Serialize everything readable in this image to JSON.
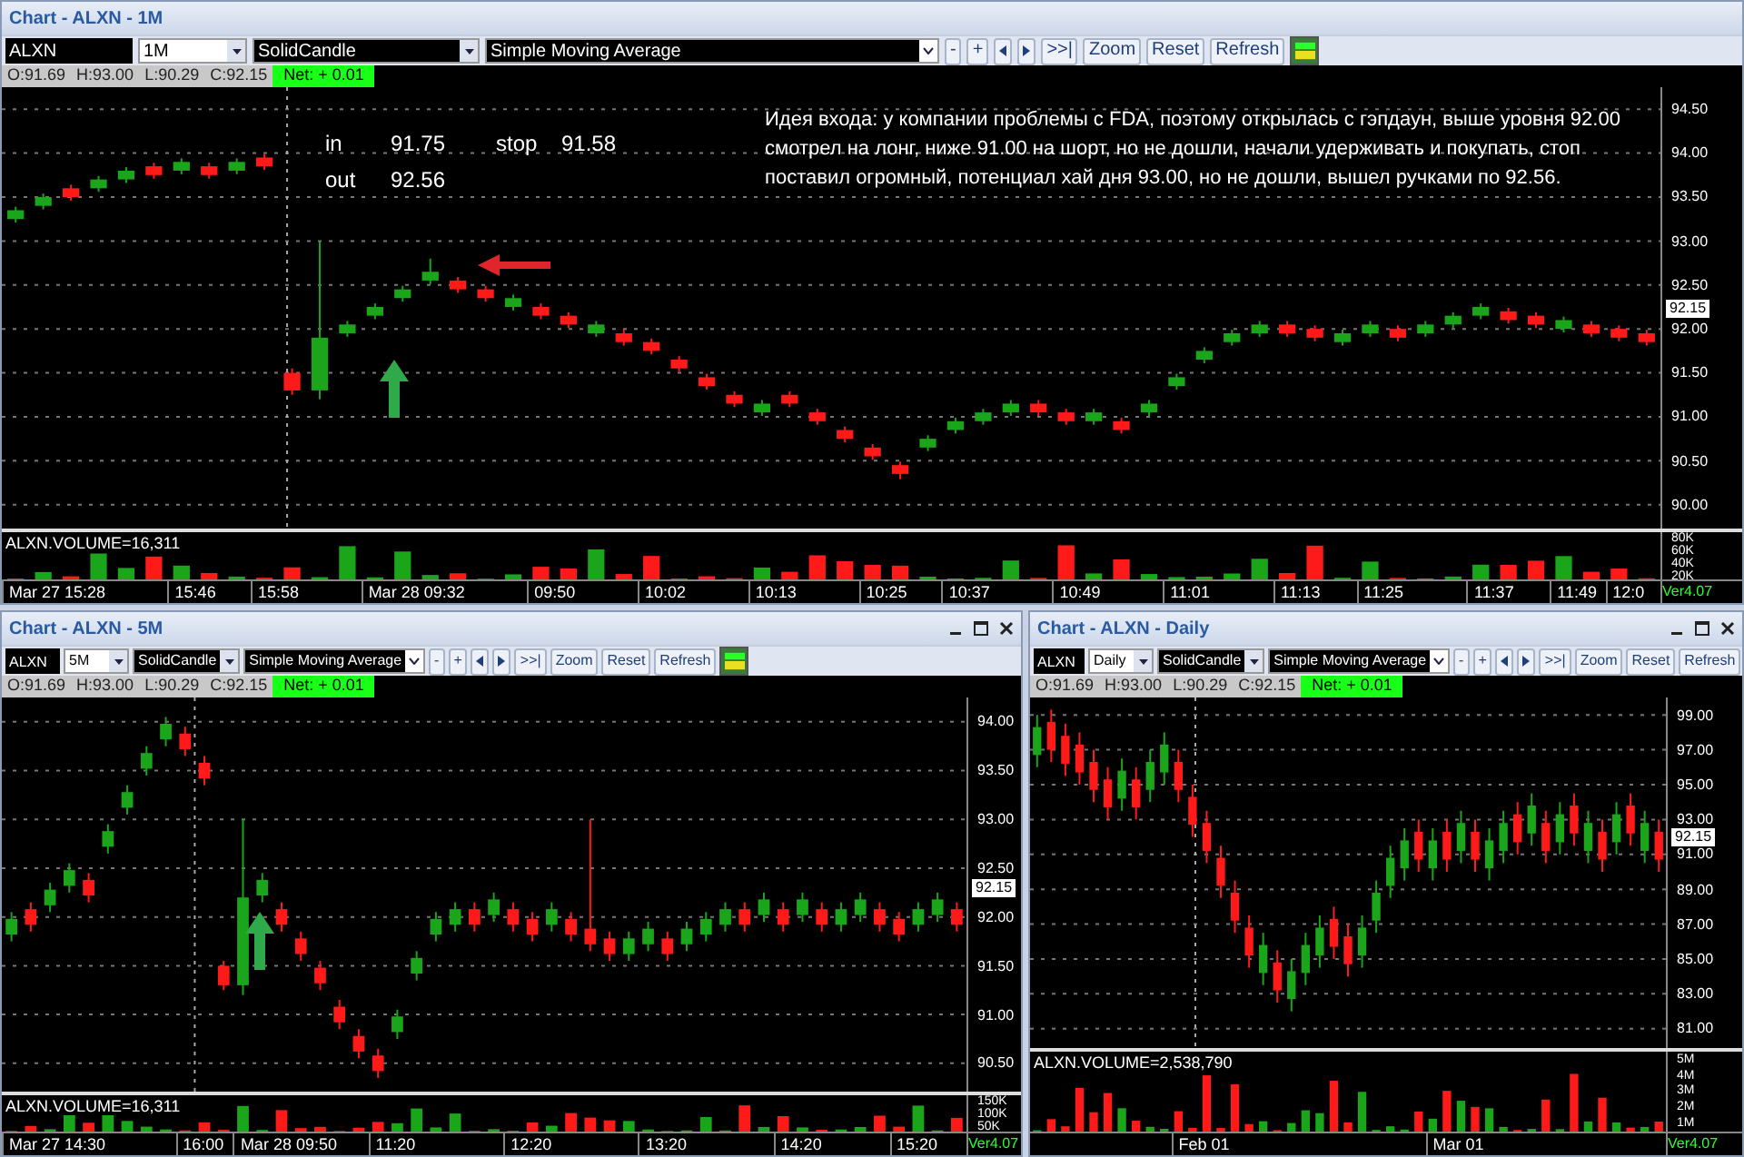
{
  "windows": [
    {
      "title": "Chart - ALXN - 1M",
      "window_controls": false,
      "symbol": "ALXN",
      "interval": "1M",
      "chart_style": "SolidCandle",
      "indicator": "Simple Moving Average",
      "step_buttons": [
        "-",
        "+"
      ],
      "action_buttons": [
        ">>|",
        "Zoom",
        "Reset",
        "Refresh"
      ],
      "quote": [
        "O:91.69",
        "H:93.00",
        "L:90.29",
        "C:92.15"
      ],
      "net": "Net: + 0.01",
      "price_tag": "92.15",
      "volume_label": "ALXN.VOLUME=16,311",
      "volume_axis": [
        "80K",
        "60K",
        "40K",
        "20K"
      ],
      "x_axis": [
        "Mar 27 15:28",
        "15:46",
        "15:58",
        "Mar 28 09:32",
        "09:50",
        "10:02",
        "10:13",
        "10:25",
        "10:37",
        "10:49",
        "11:01",
        "11:13",
        "11:25",
        "11:37",
        "11:49",
        "12:0"
      ],
      "version": "Ver4.07",
      "trade_notes": [
        [
          "in",
          "91.75",
          "stop",
          "91.58"
        ],
        [
          "out",
          "92.56"
        ]
      ],
      "comment": "Идея входа: у компании проблемы с FDA, поэтому открылась с гэпдаун, выше уровня 92.00 смотрел на лонг, ниже 91.00 на шорт, но не дошли, начали удерживать и покупать, стоп поставил огромный, потенциал хай дня 93.00,  но не дошли,   вышел ручками по 92.56.",
      "markers": [
        {
          "kind": "up-arrow"
        },
        {
          "kind": "left-arrow"
        }
      ],
      "chart_data": {
        "type": "candlestick",
        "ylim": [
          89.15,
          94.75
        ],
        "yticks": [
          {
            "value": 94.5,
            "label": "94.50"
          },
          {
            "value": 94,
            "label": "94.00"
          },
          {
            "value": 93.5,
            "label": "93.50"
          },
          {
            "value": 93,
            "label": "93.00"
          },
          {
            "value": 92.5,
            "label": "92.50"
          },
          {
            "value": 92,
            "label": "92.00"
          },
          {
            "value": 91.5,
            "label": "91.50"
          },
          {
            "value": 91,
            "label": "91.00"
          },
          {
            "value": 90.5,
            "label": "90.50"
          },
          {
            "value": 90,
            "label": "90.00"
          }
        ],
        "grid": true,
        "categories": [
          null,
          null,
          null,
          null,
          null,
          null,
          null,
          null,
          null,
          null,
          null,
          null,
          null,
          null,
          null,
          null,
          null,
          null,
          null,
          null,
          null,
          null,
          null,
          null,
          null,
          null,
          null,
          null,
          null,
          null,
          null,
          null,
          null,
          null,
          null,
          null,
          null,
          null,
          null,
          null,
          null,
          null,
          null,
          null,
          null,
          null,
          null,
          null,
          null,
          null,
          null,
          null,
          null,
          null,
          null,
          null,
          null,
          null,
          null,
          null
        ],
        "ohlc": [
          [
            93.25,
            93.39,
            93.21,
            93.35
          ],
          [
            93.4,
            93.54,
            93.36,
            93.5
          ],
          [
            93.6,
            93.64,
            93.46,
            93.5
          ],
          [
            93.6,
            93.74,
            93.56,
            93.7
          ],
          [
            93.7,
            93.84,
            93.66,
            93.8
          ],
          [
            93.85,
            93.89,
            93.71,
            93.75
          ],
          [
            93.8,
            93.94,
            93.76,
            93.9
          ],
          [
            93.85,
            93.89,
            93.71,
            93.75
          ],
          [
            93.8,
            93.94,
            93.76,
            93.9
          ],
          [
            93.95,
            93.99,
            93.81,
            93.85
          ],
          [
            91.5,
            91.55,
            91.25,
            91.3
          ],
          [
            91.3,
            93.0,
            91.2,
            91.9
          ],
          [
            91.95,
            92.09,
            91.91,
            92.05
          ],
          [
            92.15,
            92.29,
            92.11,
            92.25
          ],
          [
            92.35,
            92.49,
            92.31,
            92.45
          ],
          [
            92.55,
            92.8,
            92.51,
            92.65
          ],
          [
            92.55,
            92.59,
            92.41,
            92.45
          ],
          [
            92.45,
            92.49,
            92.31,
            92.35
          ],
          [
            92.25,
            92.39,
            92.21,
            92.35
          ],
          [
            92.25,
            92.29,
            92.11,
            92.15
          ],
          [
            92.15,
            92.19,
            92.01,
            92.05
          ],
          [
            91.95,
            92.09,
            91.91,
            92.05
          ],
          [
            91.95,
            91.99,
            91.81,
            91.85
          ],
          [
            91.85,
            91.89,
            91.71,
            91.75
          ],
          [
            91.65,
            91.69,
            91.51,
            91.55
          ],
          [
            91.45,
            91.49,
            91.31,
            91.35
          ],
          [
            91.25,
            91.29,
            91.11,
            91.15
          ],
          [
            91.05,
            91.19,
            91.01,
            91.15
          ],
          [
            91.25,
            91.29,
            91.11,
            91.15
          ],
          [
            91.05,
            91.09,
            90.91,
            90.95
          ],
          [
            90.85,
            90.89,
            90.71,
            90.75
          ],
          [
            90.65,
            90.69,
            90.51,
            90.55
          ],
          [
            90.45,
            90.49,
            90.29,
            90.35
          ],
          [
            90.65,
            90.79,
            90.61,
            90.75
          ],
          [
            90.85,
            90.99,
            90.81,
            90.95
          ],
          [
            90.95,
            91.09,
            90.91,
            91.05
          ],
          [
            91.05,
            91.19,
            91.01,
            91.15
          ],
          [
            91.15,
            91.19,
            91.01,
            91.05
          ],
          [
            91.05,
            91.09,
            90.91,
            90.95
          ],
          [
            90.95,
            91.09,
            90.91,
            91.05
          ],
          [
            90.95,
            90.99,
            90.81,
            90.85
          ],
          [
            91.05,
            91.19,
            91.01,
            91.15
          ],
          [
            91.35,
            91.49,
            91.31,
            91.45
          ],
          [
            91.65,
            91.79,
            91.61,
            91.75
          ],
          [
            91.85,
            91.99,
            91.81,
            91.95
          ],
          [
            91.95,
            92.09,
            91.91,
            92.05
          ],
          [
            92.05,
            92.09,
            91.91,
            91.95
          ],
          [
            92.0,
            92.04,
            91.86,
            91.9
          ],
          [
            91.85,
            91.99,
            91.81,
            91.95
          ],
          [
            91.95,
            92.09,
            91.91,
            92.05
          ],
          [
            92.0,
            92.04,
            91.86,
            91.9
          ],
          [
            91.95,
            92.09,
            91.91,
            92.05
          ],
          [
            92.05,
            92.19,
            92.01,
            92.15
          ],
          [
            92.15,
            92.29,
            92.11,
            92.25
          ],
          [
            92.2,
            92.24,
            92.06,
            92.1
          ],
          [
            92.15,
            92.19,
            92.01,
            92.05
          ],
          [
            92.0,
            92.14,
            91.96,
            92.1
          ],
          [
            92.05,
            92.09,
            91.91,
            91.95
          ],
          [
            92.0,
            92.04,
            91.86,
            91.9
          ],
          [
            91.95,
            91.99,
            91.81,
            91.85
          ]
        ]
      }
    },
    {
      "title": "Chart - ALXN - 5M",
      "window_controls": true,
      "symbol": "ALXN",
      "interval": "5M",
      "chart_style": "SolidCandle",
      "indicator": "Simple Moving Average",
      "step_buttons": [
        "-",
        "+"
      ],
      "action_buttons": [
        ">>|",
        "Zoom",
        "Reset",
        "Refresh"
      ],
      "quote": [
        "O:91.69",
        "H:93.00",
        "L:90.29",
        "C:92.15"
      ],
      "net": "Net: + 0.01",
      "price_tag": "92.15",
      "volume_label": "ALXN.VOLUME=16,311",
      "volume_axis": [
        "150K",
        "100K",
        "50K"
      ],
      "x_axis": [
        "Mar 27 14:30",
        "16:00",
        "Mar 28 09:50",
        "11:20",
        "12:20",
        "13:20",
        "14:20",
        "15:20"
      ],
      "version": "Ver4.07",
      "markers": [
        {
          "kind": "up-arrow"
        }
      ],
      "chart_data": {
        "type": "candlestick",
        "ylim": [
          89.8,
          94.25
        ],
        "yticks": [
          {
            "value": 94,
            "label": "94.00"
          },
          {
            "value": 93.5,
            "label": "93.50"
          },
          {
            "value": 93,
            "label": "93.00"
          },
          {
            "value": 92.5,
            "label": "92.50"
          },
          {
            "value": 92,
            "label": "92.00"
          },
          {
            "value": 91.5,
            "label": "91.50"
          },
          {
            "value": 91,
            "label": "91.00"
          },
          {
            "value": 90.5,
            "label": "90.50"
          }
        ],
        "grid": true,
        "categories": [
          null,
          null,
          null,
          null,
          null,
          null,
          null,
          null,
          null,
          null,
          null,
          null,
          null,
          null,
          null,
          null,
          null,
          null,
          null,
          null,
          null,
          null,
          null,
          null,
          null,
          null,
          null,
          null,
          null,
          null,
          null,
          null,
          null,
          null,
          null,
          null,
          null,
          null,
          null,
          null,
          null,
          null,
          null,
          null,
          null,
          null,
          null,
          null,
          null,
          null
        ],
        "ohlc": [
          [
            91.82,
            92.05,
            91.75,
            91.98
          ],
          [
            92.08,
            92.15,
            91.85,
            91.92
          ],
          [
            92.12,
            92.35,
            92.05,
            92.28
          ],
          [
            92.32,
            92.55,
            92.25,
            92.48
          ],
          [
            92.38,
            92.45,
            92.15,
            92.22
          ],
          [
            92.72,
            92.95,
            92.65,
            92.88
          ],
          [
            93.12,
            93.35,
            93.05,
            93.28
          ],
          [
            93.52,
            93.75,
            93.45,
            93.68
          ],
          [
            93.82,
            94.05,
            93.75,
            93.98
          ],
          [
            93.88,
            93.95,
            93.65,
            93.72
          ],
          [
            93.58,
            93.65,
            93.35,
            93.42
          ],
          [
            91.5,
            91.55,
            91.25,
            91.3
          ],
          [
            91.3,
            93.0,
            91.2,
            92.2
          ],
          [
            92.22,
            92.45,
            92.15,
            92.38
          ],
          [
            92.08,
            92.15,
            91.85,
            91.92
          ],
          [
            91.78,
            91.85,
            91.55,
            91.62
          ],
          [
            91.48,
            91.55,
            91.25,
            91.32
          ],
          [
            91.08,
            91.15,
            90.85,
            90.92
          ],
          [
            90.78,
            90.85,
            90.55,
            90.62
          ],
          [
            90.58,
            90.65,
            90.35,
            90.42
          ],
          [
            90.82,
            91.05,
            90.75,
            90.98
          ],
          [
            91.42,
            91.65,
            91.35,
            91.58
          ],
          [
            91.82,
            92.05,
            91.75,
            91.98
          ],
          [
            91.92,
            92.15,
            91.85,
            92.08
          ],
          [
            92.08,
            92.15,
            91.85,
            91.92
          ],
          [
            92.02,
            92.25,
            91.95,
            92.18
          ],
          [
            92.08,
            92.15,
            91.85,
            91.92
          ],
          [
            91.98,
            92.05,
            91.75,
            91.82
          ],
          [
            91.92,
            92.15,
            91.85,
            92.08
          ],
          [
            91.98,
            92.05,
            91.75,
            91.82
          ],
          [
            91.88,
            93.0,
            91.65,
            91.72
          ],
          [
            91.78,
            91.85,
            91.55,
            91.62
          ],
          [
            91.62,
            91.85,
            91.55,
            91.78
          ],
          [
            91.72,
            91.95,
            91.65,
            91.88
          ],
          [
            91.78,
            91.85,
            91.55,
            91.62
          ],
          [
            91.72,
            91.95,
            91.65,
            91.88
          ],
          [
            91.82,
            92.05,
            91.75,
            91.98
          ],
          [
            91.92,
            92.15,
            91.85,
            92.08
          ],
          [
            92.08,
            92.15,
            91.85,
            91.92
          ],
          [
            92.02,
            92.25,
            91.95,
            92.18
          ],
          [
            92.08,
            92.15,
            91.85,
            91.92
          ],
          [
            92.02,
            92.25,
            91.95,
            92.18
          ],
          [
            92.08,
            92.15,
            91.85,
            91.92
          ],
          [
            91.92,
            92.15,
            91.85,
            92.08
          ],
          [
            92.02,
            92.25,
            91.95,
            92.18
          ],
          [
            92.08,
            92.15,
            91.85,
            91.92
          ],
          [
            91.98,
            92.05,
            91.75,
            91.82
          ],
          [
            91.92,
            92.15,
            91.85,
            92.08
          ],
          [
            92.02,
            92.25,
            91.95,
            92.18
          ],
          [
            92.08,
            92.15,
            91.85,
            91.92
          ]
        ]
      }
    },
    {
      "title": "Chart - ALXN - Daily",
      "window_controls": true,
      "symbol": "ALXN",
      "interval": "Daily",
      "chart_style": "SolidCandle",
      "indicator": "Simple Moving Average",
      "step_buttons": [
        "-",
        "+"
      ],
      "action_buttons": [
        ">>|",
        "Zoom",
        "Reset",
        "Refresh"
      ],
      "quote": [
        "O:91.69",
        "H:93.00",
        "L:90.29",
        "C:92.15"
      ],
      "net": "Net: + 0.01",
      "price_tag": "92.15",
      "volume_label": "ALXN.VOLUME=2,538,790",
      "volume_axis": [
        "5M",
        "4M",
        "3M",
        "2M",
        "1M"
      ],
      "x_axis": [
        "Feb 01",
        "Mar 01"
      ],
      "version": "Ver4.07",
      "chart_data": {
        "type": "candlestick",
        "ylim": [
          75.1,
          100
        ],
        "yticks": [
          {
            "value": 99,
            "label": "99.00"
          },
          {
            "value": 97,
            "label": "97.00"
          },
          {
            "value": 95,
            "label": "95.00"
          },
          {
            "value": 93,
            "label": "93.00"
          },
          {
            "value": 91,
            "label": "91.00"
          },
          {
            "value": 89,
            "label": "89.00"
          },
          {
            "value": 87,
            "label": "87.00"
          },
          {
            "value": 85,
            "label": "85.00"
          },
          {
            "value": 83,
            "label": "83.00"
          },
          {
            "value": 81,
            "label": "81.00"
          }
        ],
        "grid": true,
        "categories": [
          null,
          null,
          null,
          null,
          null,
          null,
          null,
          null,
          null,
          null,
          null,
          null,
          null,
          null,
          null,
          null,
          null,
          null,
          null,
          null,
          null,
          null,
          null,
          null,
          null,
          null,
          null,
          null,
          null,
          null,
          null,
          null,
          null,
          null,
          null,
          null,
          null,
          null,
          null,
          null,
          null,
          null,
          null,
          null,
          null
        ],
        "ohlc": [
          [
            96.7,
            99.0,
            96.0,
            98.3
          ],
          [
            98.6,
            99.3,
            96.3,
            97.0
          ],
          [
            97.8,
            98.5,
            95.5,
            96.2
          ],
          [
            97.3,
            98.0,
            95.0,
            95.7
          ],
          [
            96.3,
            97.0,
            94.0,
            94.7
          ],
          [
            95.3,
            96.0,
            93.0,
            93.7
          ],
          [
            94.2,
            96.5,
            93.5,
            95.8
          ],
          [
            95.3,
            96.0,
            93.0,
            93.7
          ],
          [
            94.7,
            97.0,
            94.0,
            96.3
          ],
          [
            95.7,
            98.0,
            95.0,
            97.3
          ],
          [
            96.3,
            97.0,
            94.0,
            94.7
          ],
          [
            94.3,
            95.0,
            92.0,
            92.7
          ],
          [
            92.8,
            93.5,
            90.5,
            91.2
          ],
          [
            90.8,
            91.5,
            88.5,
            89.2
          ],
          [
            88.8,
            89.5,
            86.5,
            87.2
          ],
          [
            86.8,
            87.5,
            84.5,
            85.2
          ],
          [
            84.2,
            86.5,
            83.5,
            85.8
          ],
          [
            84.8,
            85.5,
            82.5,
            83.2
          ],
          [
            82.7,
            85.0,
            82.0,
            84.3
          ],
          [
            84.2,
            86.5,
            83.5,
            85.8
          ],
          [
            85.2,
            87.5,
            84.5,
            86.8
          ],
          [
            87.3,
            88.0,
            85.0,
            85.7
          ],
          [
            86.3,
            87.0,
            84.0,
            84.7
          ],
          [
            85.2,
            87.5,
            84.5,
            86.8
          ],
          [
            87.2,
            89.5,
            86.5,
            88.8
          ],
          [
            89.2,
            91.5,
            88.5,
            90.8
          ],
          [
            90.2,
            92.5,
            89.5,
            91.8
          ],
          [
            92.3,
            93.0,
            90.0,
            90.7
          ],
          [
            90.2,
            92.5,
            89.5,
            91.8
          ],
          [
            92.3,
            93.0,
            90.0,
            90.7
          ],
          [
            91.2,
            93.5,
            90.5,
            92.8
          ],
          [
            92.3,
            93.0,
            90.0,
            90.7
          ],
          [
            90.2,
            92.5,
            89.5,
            91.8
          ],
          [
            91.2,
            93.5,
            90.5,
            92.8
          ],
          [
            93.3,
            94.0,
            91.0,
            91.7
          ],
          [
            92.2,
            94.5,
            91.5,
            93.8
          ],
          [
            92.8,
            93.5,
            90.5,
            91.2
          ],
          [
            91.7,
            94.0,
            91.0,
            93.3
          ],
          [
            93.8,
            94.5,
            91.5,
            92.2
          ],
          [
            91.2,
            93.5,
            90.5,
            92.8
          ],
          [
            92.3,
            93.0,
            90.0,
            90.7
          ],
          [
            91.7,
            94.0,
            91.0,
            93.3
          ],
          [
            93.8,
            94.5,
            91.5,
            92.2
          ],
          [
            91.2,
            93.5,
            90.5,
            92.8
          ],
          [
            92.3,
            93.0,
            90.0,
            90.7
          ]
        ]
      }
    }
  ]
}
